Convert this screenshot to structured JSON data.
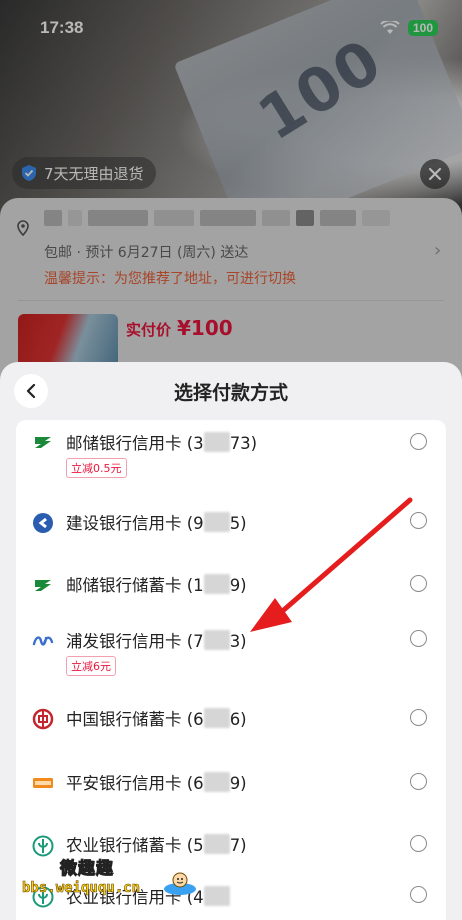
{
  "status_bar": {
    "time": "17:38",
    "battery": "100"
  },
  "photo": {
    "banknote_text": "100"
  },
  "return_badge": {
    "label": "7天无理由退货"
  },
  "order": {
    "delivery": "包邮 · 预计 6月27日 (周六) 送达",
    "tip": "温馨提示：为您推荐了地址，可进行切换",
    "price_label": "实付价",
    "price_value": "¥100"
  },
  "payment": {
    "title": "选择付款方式",
    "methods": [
      {
        "bank": "邮储银行信用卡",
        "prefix": "(3",
        "suffix": "73)",
        "icon": "psbc-logo-icon",
        "discount": "立减0.5元"
      },
      {
        "bank": "建设银行信用卡",
        "prefix": "(9",
        "suffix": "5)",
        "icon": "ccb-logo-icon",
        "discount": ""
      },
      {
        "bank": "邮储银行储蓄卡",
        "prefix": "(1",
        "suffix": "9)",
        "icon": "psbc-logo-icon",
        "discount": ""
      },
      {
        "bank": "浦发银行信用卡",
        "prefix": "(7",
        "suffix": "3)",
        "icon": "spdb-logo-icon",
        "discount": "立减6元"
      },
      {
        "bank": "中国银行储蓄卡",
        "prefix": "(6",
        "suffix": "6)",
        "icon": "boc-logo-icon",
        "discount": ""
      },
      {
        "bank": "平安银行信用卡",
        "prefix": "(6",
        "suffix": "9)",
        "icon": "pingan-logo-icon",
        "discount": ""
      },
      {
        "bank": "农业银行储蓄卡",
        "prefix": "(5",
        "suffix": "7)",
        "icon": "abc-logo-icon",
        "discount": ""
      },
      {
        "bank": "农业银行信用卡",
        "prefix": "(4",
        "suffix": "",
        "icon": "abc-logo-icon",
        "discount": ""
      }
    ]
  },
  "watermark": {
    "cn": "微趣趣",
    "url": "bbs.weiququ.cn"
  },
  "colors": {
    "accent_red": "#e8163d",
    "tip_orange": "#e8623a",
    "psbc_green": "#1a8a3a",
    "ccb_blue": "#2a5db0",
    "spdb_blue": "#3b6fd0",
    "boc_red": "#c4262e",
    "pingan_orange": "#f08a1c",
    "abc_green": "#1a9a7a"
  }
}
